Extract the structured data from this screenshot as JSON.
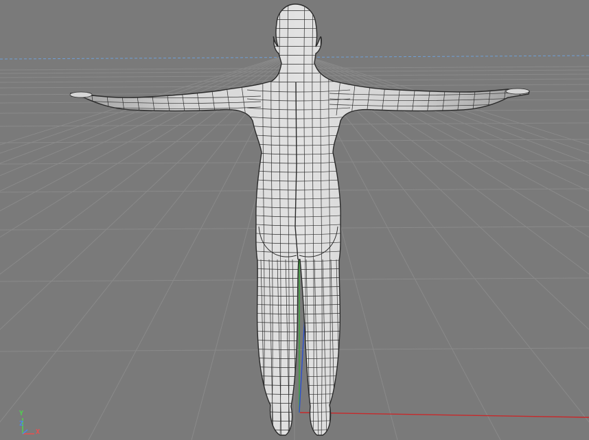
{
  "viewport": {
    "background": "#7a7a7a",
    "grid_color": "#8a8a8a",
    "horizon_color": "#6fa0d8"
  },
  "model": {
    "surface_color": "#d6d6d6",
    "wire_color": "#2a2a2a"
  },
  "world_axes": {
    "x_color": "#c8282a",
    "y_color": "#3aa83a",
    "z_color": "#2d4fd0"
  },
  "axis_gizmo": {
    "y_label": "Y",
    "z_label": "Z",
    "x_label": "X",
    "y_color": "#4fd24f",
    "z_color": "#4f86e8",
    "x_color": "#e85050"
  }
}
